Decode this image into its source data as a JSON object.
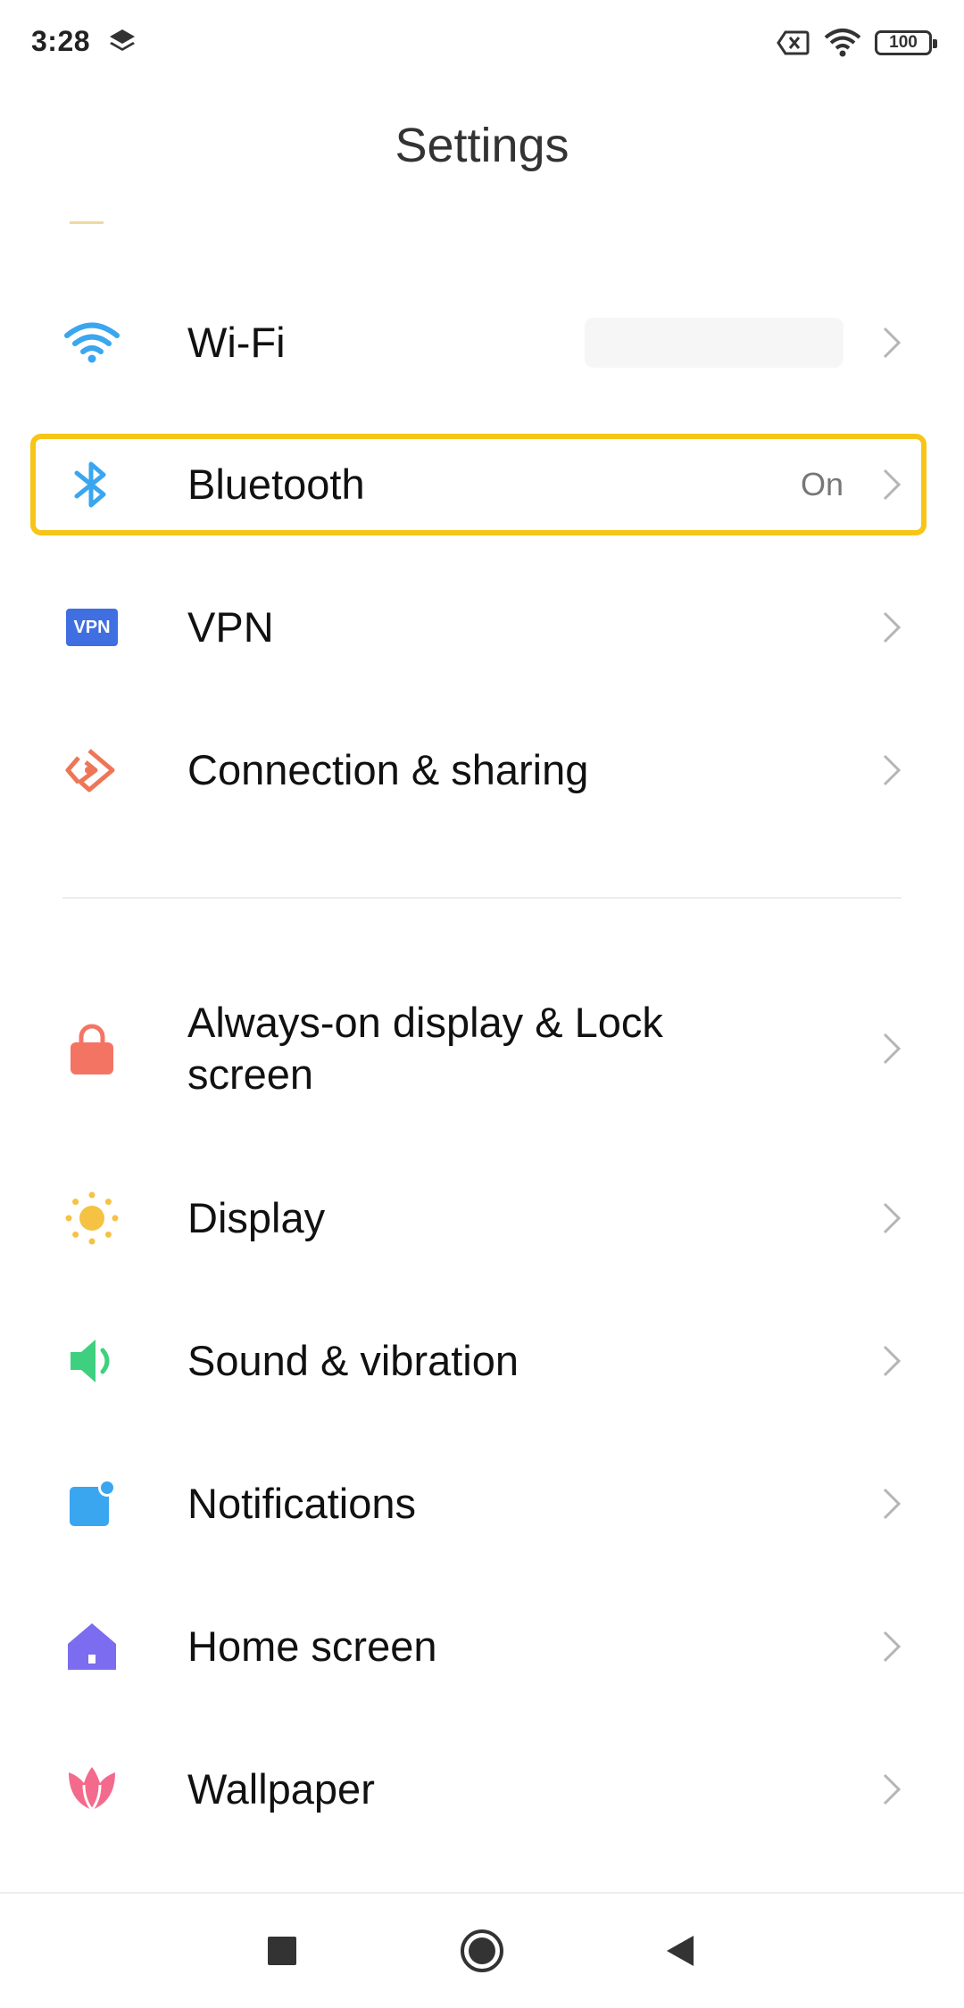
{
  "status_bar": {
    "time": "3:28",
    "left_icon": "layers-icon",
    "right_icons": [
      "sim-blocked-icon",
      "wifi-icon"
    ],
    "battery": "100"
  },
  "header": {
    "title": "Settings"
  },
  "connections": [
    {
      "id": "wifi",
      "label": "Wi-Fi",
      "icon": "wifi-icon",
      "value": "",
      "value_hidden": true
    },
    {
      "id": "bluetooth",
      "label": "Bluetooth",
      "icon": "bluetooth-icon",
      "value": "On",
      "highlighted": true
    },
    {
      "id": "vpn",
      "label": "VPN",
      "icon": "vpn-icon",
      "icon_text": "VPN",
      "value": ""
    },
    {
      "id": "connection-sharing",
      "label": "Connection & sharing",
      "icon": "connection-sharing-icon",
      "value": ""
    }
  ],
  "personalization": [
    {
      "id": "always-on",
      "label": "Always-on display & Lock screen",
      "icon": "lock-icon"
    },
    {
      "id": "display",
      "label": "Display",
      "icon": "sun-icon"
    },
    {
      "id": "sound",
      "label": "Sound & vibration",
      "icon": "speaker-icon"
    },
    {
      "id": "notifications",
      "label": "Notifications",
      "icon": "notification-icon"
    },
    {
      "id": "home-screen",
      "label": "Home screen",
      "icon": "home-icon"
    },
    {
      "id": "wallpaper",
      "label": "Wallpaper",
      "icon": "tulip-icon"
    }
  ],
  "nav_bar": [
    "recents-button",
    "home-button",
    "back-button"
  ],
  "colors": {
    "highlight": "#f6c518",
    "wifi": "#3aa6f0",
    "bluetooth": "#3aa6f0",
    "vpn": "#3f6fe0",
    "connection": "#ee7656",
    "lock": "#f47464",
    "display": "#f5c244",
    "sound": "#3fd07f",
    "notifications": "#3aa6f0",
    "home": "#7b6cf0",
    "wallpaper": "#f46a8c"
  }
}
